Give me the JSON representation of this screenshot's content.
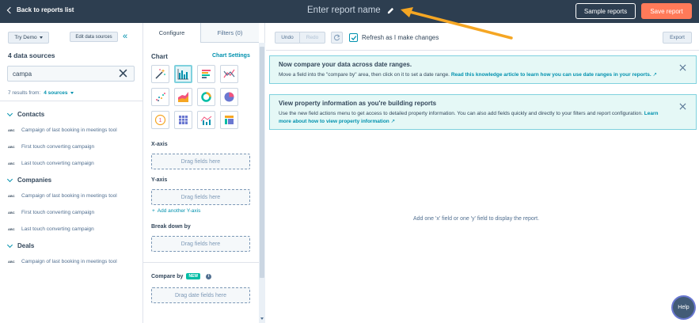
{
  "header": {
    "back_label": "Back to reports list",
    "report_name": "Enter report name",
    "sample_label": "Sample reports",
    "save_label": "Save report"
  },
  "left_panel": {
    "try_demo": "Try Demo",
    "edit_data_sources": "Edit data sources",
    "data_source_count": "4 data sources",
    "search_value": "campa",
    "results_prefix": "7 results from:",
    "results_sources": "4 sources",
    "groups": [
      {
        "name": "Contacts",
        "fields": [
          "Campaign of last booking in meetings tool",
          "First touch converting campaign",
          "Last touch converting campaign"
        ]
      },
      {
        "name": "Companies",
        "fields": [
          "Campaign of last booking in meetings tool",
          "First touch converting campaign",
          "Last touch converting campaign"
        ]
      },
      {
        "name": "Deals",
        "fields": [
          "Campaign of last booking in meetings tool"
        ]
      }
    ],
    "field_type": "ABC"
  },
  "config_panel": {
    "tab_configure": "Configure",
    "tab_filters": "Filters (0)",
    "chart_label": "Chart",
    "chart_settings": "Chart Settings",
    "x_axis_label": "X-axis",
    "y_axis_label": "Y-axis",
    "breakdown_label": "Break down by",
    "drop_placeholder": "Drag fields here",
    "add_y_axis": "Add another Y-axis",
    "compare_label": "Compare by",
    "new_badge": "NEW",
    "date_drop_placeholder": "Drag date fields here",
    "info_glyph": "i",
    "chart_types": [
      "magic-wand-icon",
      "column-chart-icon",
      "bar-chart-icon",
      "line-chart-icon",
      "scatter-chart-icon",
      "area-chart-icon",
      "donut-chart-icon",
      "pie-chart-icon",
      "summary-number-icon",
      "table-icon",
      "combination-chart-icon",
      "pivot-table-icon"
    ]
  },
  "toolbar": {
    "undo": "Undo",
    "redo": "Redo",
    "refresh_label": "Refresh as I make changes",
    "refresh_checked": true,
    "export": "Export"
  },
  "banners": [
    {
      "title": "Now compare your data across date ranges.",
      "body": "Move a field into the \"compare by\" area, then click on it to set a date range.",
      "link": "Read this knowledge article to learn how you can use date ranges in your reports."
    },
    {
      "title": "View property information as you're building reports",
      "body": "Use the new field actions menu to get access to detailed property information. You can also add fields quickly and directly to your filters and report configuration.",
      "link": "Learn more about how to view property information"
    }
  ],
  "empty_message": "Add one 'x' field or one 'y' field to display the report.",
  "help_label": "Help",
  "colors": {
    "header_bg": "#2d3e50",
    "accent": "#0091ae",
    "save": "#ff7a59",
    "banner_bg": "#e5f8f6",
    "arrow": "#f5a623"
  }
}
